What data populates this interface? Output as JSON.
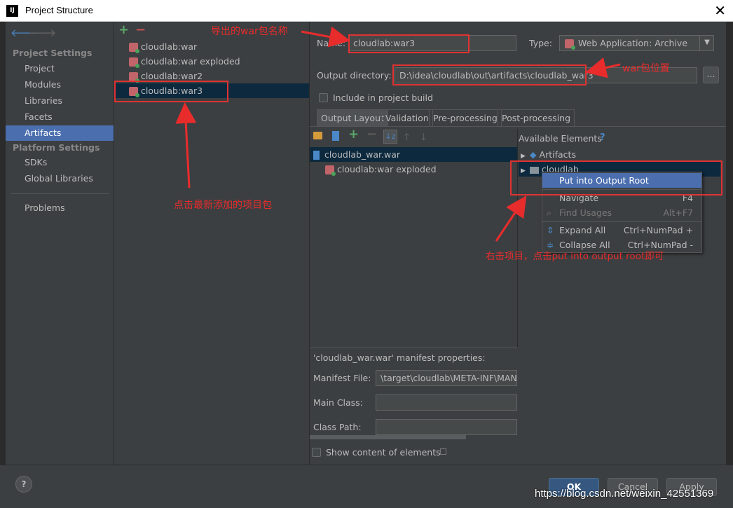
{
  "window": {
    "logo_text": "IJ",
    "title": "Project Structure",
    "close_glyph": "✕"
  },
  "nav": {
    "back_glyph": "🡐",
    "forward_glyph": "🡒",
    "project_settings_header": "Project Settings",
    "project_settings_items": [
      "Project",
      "Modules",
      "Libraries",
      "Facets",
      "Artifacts"
    ],
    "selected_item": "Artifacts",
    "platform_settings_header": "Platform Settings",
    "platform_settings_items": [
      "SDKs",
      "Global Libraries"
    ],
    "problems_label": "Problems"
  },
  "artifacts": {
    "add_glyph": "+",
    "remove_glyph": "−",
    "items": [
      "cloudlab:war",
      "cloudlab:war exploded",
      "cloudlab:war2",
      "cloudlab:war3"
    ],
    "selected": "cloudlab:war3"
  },
  "form": {
    "name_label": "Name:",
    "name_value": "cloudlab:war3",
    "type_label": "Type:",
    "type_value": "Web Application: Archive",
    "output_dir_label": "Output directory:",
    "output_dir_value": "D:\\idea\\cloudlab\\out\\artifacts\\cloudlab_war3",
    "browse_label": "...",
    "include_build_label": "Include in project build"
  },
  "tabs": [
    "Output Layout",
    "Validation",
    "Pre-processing",
    "Post-processing"
  ],
  "active_tab": "Output Layout",
  "layout_tree": {
    "root": "cloudlab_war.war",
    "child": "cloudlab:war exploded"
  },
  "available": {
    "header": "Available Elements",
    "help_glyph": "?",
    "items": [
      "Artifacts",
      "cloudlab"
    ]
  },
  "context_menu": {
    "items": [
      {
        "label": "Put into Output Root",
        "shortcut": ""
      },
      {
        "label": "Navigate",
        "shortcut": "F4"
      },
      {
        "label": "Find Usages",
        "shortcut": "Alt+F7"
      },
      {
        "label": "Expand All",
        "shortcut": "Ctrl+NumPad +"
      },
      {
        "label": "Collapse All",
        "shortcut": "Ctrl+NumPad -"
      }
    ]
  },
  "manifest": {
    "title": "'cloudlab_war.war' manifest properties:",
    "file_label": "Manifest File:",
    "file_value": "\\target\\cloudlab\\META-INF\\MANI",
    "main_class_label": "Main Class:",
    "class_path_label": "Class Path:"
  },
  "show_content_label": "Show content of elements",
  "buttons": {
    "help": "?",
    "ok": "OK",
    "cancel": "Cancel",
    "apply": "Apply"
  },
  "annotations": {
    "war_name": "导出的war包名称",
    "war_location": "war包位置",
    "click_latest": "点击最新添加的项目包",
    "right_click": "右击项目，点击put into output root即可"
  },
  "watermark": "https://blog.csdn.net/weixin_42551369",
  "colors": {
    "annotation_red": "#e82c2c",
    "selection_blue": "#4b6eaf",
    "tree_selection": "#0d293e"
  }
}
